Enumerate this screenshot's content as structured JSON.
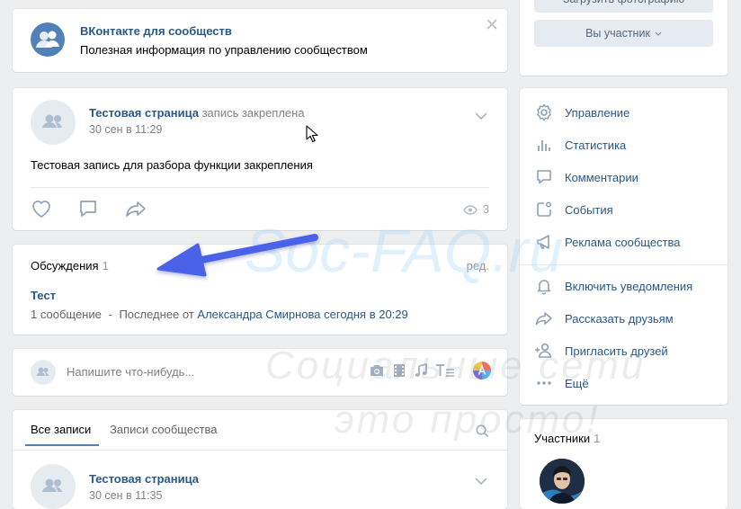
{
  "banner": {
    "title": "ВКонтакте для сообществ",
    "description": "Полезная информация по управлению сообществом"
  },
  "post": {
    "author": "Тестовая страница",
    "status": "запись закреплена",
    "date": "30 сен в 11:29",
    "text": "Тестовая запись для разбора функции закрепления",
    "views": "3"
  },
  "discussions": {
    "title": "Обсуждения",
    "count": "1",
    "edit_label": "ред.",
    "topic": "Тест",
    "messages": "1 сообщение",
    "separator": "-",
    "last_from": "Последнее от",
    "last_author": "Александра Смирнова",
    "last_time": "сегодня в 20:29"
  },
  "composer": {
    "placeholder": "Напишите что-нибудь..."
  },
  "feed": {
    "tab_all": "Все записи",
    "tab_community": "Записи сообщества",
    "post_author": "Тестовая страница",
    "post_date": "30 сен в 11:35"
  },
  "sidebar": {
    "upload_label": "Загрузить фотографию",
    "member_label": "Вы участник",
    "menu": [
      {
        "label": "Управление",
        "icon": "gear-icon"
      },
      {
        "label": "Статистика",
        "icon": "stats-icon"
      },
      {
        "label": "Комментарии",
        "icon": "comment-icon"
      },
      {
        "label": "События",
        "icon": "events-icon"
      },
      {
        "label": "Реклама сообщества",
        "icon": "megaphone-icon"
      }
    ],
    "actions": [
      {
        "label": "Включить уведомления",
        "icon": "bell-icon"
      },
      {
        "label": "Рассказать друзьям",
        "icon": "share-icon"
      },
      {
        "label": "Пригласить друзей",
        "icon": "add-user-icon"
      },
      {
        "label": "Ещё",
        "icon": "more-icon"
      }
    ],
    "members_title": "Участники",
    "members_count": "1"
  },
  "watermark": {
    "site": "Soc-FAQ.ru",
    "line1": "Социальные сети",
    "line2": "это просто!"
  },
  "colors": {
    "link": "#2a5885",
    "accent": "#5181b8",
    "background": "#edeef0",
    "arrow": "#4a62e8"
  }
}
